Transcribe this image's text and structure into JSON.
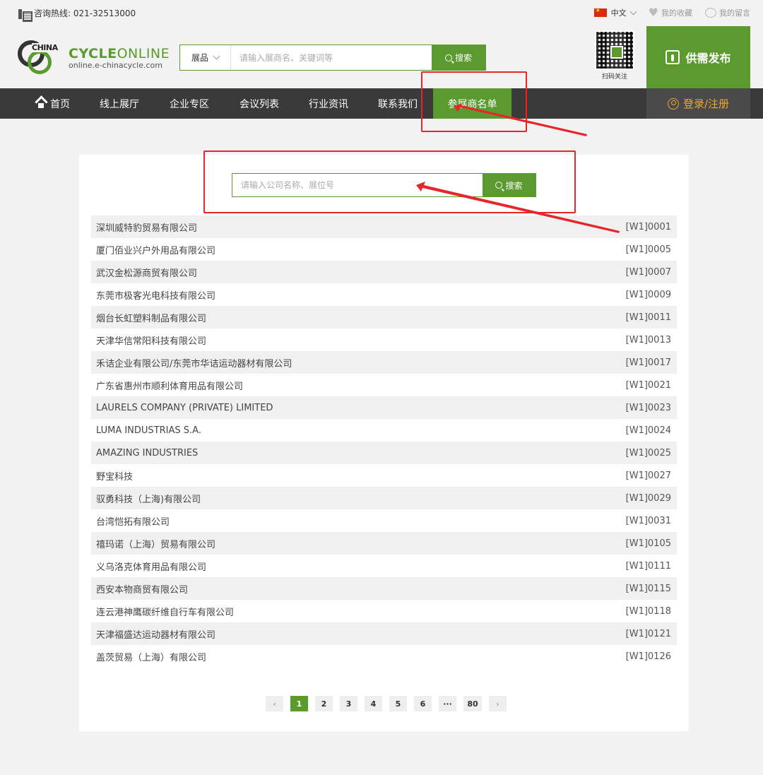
{
  "topbar": {
    "hotline": "咨询热线: 021-32513000",
    "language": "中文",
    "favorites": "我的收藏",
    "messages": "我的留言"
  },
  "header": {
    "logo_title_bold": "CYCLE",
    "logo_title_thin": "ONLINE",
    "logo_mark_text": "CHINA",
    "logo_sub": "online.e-chinacycle.com",
    "search_category": "展品",
    "search_placeholder": "请输入展商名、关键词等",
    "search_button": "搜索",
    "qr_label": "扫码关注",
    "supply_button": "供需发布"
  },
  "nav": {
    "items": [
      "首页",
      "线上展厅",
      "企业专区",
      "会议列表",
      "行业资讯",
      "联系我们",
      "参展商名单"
    ],
    "active_index": 6,
    "login": "登录/注册"
  },
  "exhibitor_search": {
    "placeholder": "请输入公司名称、展位号",
    "button": "搜索"
  },
  "exhibitors": [
    {
      "name": "深圳威特豹贸易有限公司",
      "booth": "[W1]0001"
    },
    {
      "name": "厦门佰业兴户外用品有限公司",
      "booth": "[W1]0005"
    },
    {
      "name": "武汉金松源商贸有限公司",
      "booth": "[W1]0007"
    },
    {
      "name": "东莞市极客光电科技有限公司",
      "booth": "[W1]0009"
    },
    {
      "name": "烟台长虹塑料制品有限公司",
      "booth": "[W1]0011"
    },
    {
      "name": "天津华信常阳科技有限公司",
      "booth": "[W1]0013"
    },
    {
      "name": "禾诘企业有限公司/东莞市华诘运动器材有限公司",
      "booth": "[W1]0017"
    },
    {
      "name": "广东省惠州市顺利体育用品有限公司",
      "booth": "[W1]0021"
    },
    {
      "name": "LAURELS COMPANY (PRIVATE) LIMITED",
      "booth": "[W1]0023"
    },
    {
      "name": "LUMA INDUSTRIAS S.A.",
      "booth": "[W1]0024"
    },
    {
      "name": "AMAZING INDUSTRIES",
      "booth": "[W1]0025"
    },
    {
      "name": "野宝科技",
      "booth": "[W1]0027"
    },
    {
      "name": "驭勇科技（上海)有限公司",
      "booth": "[W1]0029"
    },
    {
      "name": "台湾恺拓有限公司",
      "booth": "[W1]0031"
    },
    {
      "name": "禧玛诺（上海）贸易有限公司",
      "booth": "[W1]0105"
    },
    {
      "name": "义乌洛克体育用品有限公司",
      "booth": "[W1]0111"
    },
    {
      "name": "西安本物商贸有限公司",
      "booth": "[W1]0115"
    },
    {
      "name": "连云港神鹰碳纤维自行车有限公司",
      "booth": "[W1]0118"
    },
    {
      "name": "天津福盛达运动器材有限公司",
      "booth": "[W1]0121"
    },
    {
      "name": "盖茨贸易（上海）有限公司",
      "booth": "[W1]0126"
    }
  ],
  "pagination": {
    "prev": "‹",
    "pages": [
      "1",
      "2",
      "3",
      "4",
      "5",
      "6",
      "···",
      "80"
    ],
    "current": "1",
    "next": "›"
  },
  "colors": {
    "brand_green": "#5a9a2f",
    "nav_dark": "#3a3a3a",
    "login_orange": "#f0a530",
    "annotation_red": "#e8252b"
  }
}
